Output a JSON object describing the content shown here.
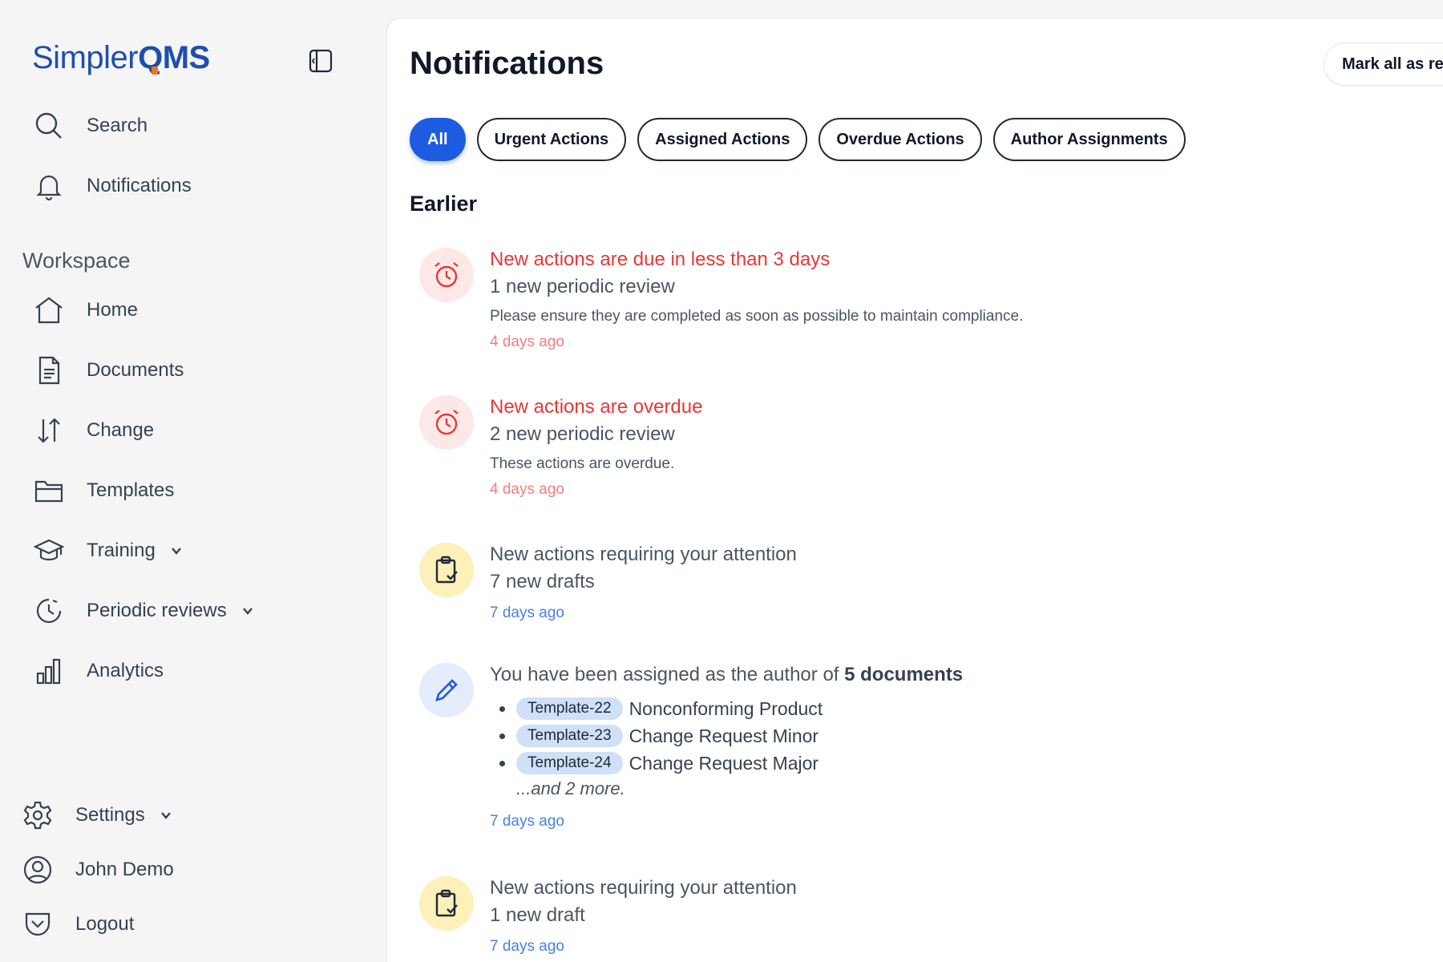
{
  "brand": {
    "name_light": "Simpler",
    "name_q": "Q",
    "name_bold": "MS"
  },
  "sidebar": {
    "top_items": [
      {
        "label": "Search",
        "icon": "search-icon"
      },
      {
        "label": "Notifications",
        "icon": "bell-icon"
      }
    ],
    "section_label": "Workspace",
    "workspace_items": [
      {
        "label": "Home",
        "icon": "home-icon"
      },
      {
        "label": "Documents",
        "icon": "document-icon"
      },
      {
        "label": "Change",
        "icon": "arrows-up-down-icon"
      },
      {
        "label": "Templates",
        "icon": "folder-icon"
      },
      {
        "label": "Training",
        "icon": "graduation-cap-icon",
        "expandable": true
      },
      {
        "label": "Periodic reviews",
        "icon": "clock-cycle-icon",
        "expandable": true
      },
      {
        "label": "Analytics",
        "icon": "bar-chart-icon"
      }
    ],
    "bottom_items": [
      {
        "label": "Settings",
        "icon": "gear-icon",
        "expandable": true
      },
      {
        "label": "John Demo",
        "icon": "user-circle-icon"
      },
      {
        "label": "Logout",
        "icon": "logout-icon"
      }
    ]
  },
  "main": {
    "title": "Notifications",
    "mark_all_label": "Mark all as re",
    "filters": [
      {
        "label": "All",
        "active": true
      },
      {
        "label": "Urgent Actions",
        "active": false
      },
      {
        "label": "Assigned Actions",
        "active": false
      },
      {
        "label": "Overdue Actions",
        "active": false
      },
      {
        "label": "Author Assignments",
        "active": false
      }
    ],
    "group_label": "Earlier",
    "notifications": [
      {
        "type": "urgent",
        "icon": "alarm-clock-icon",
        "title": "New actions are due in less than 3 days",
        "subtitle": "1 new periodic review",
        "description": "Please ensure they are completed as soon as possible to maintain compliance.",
        "time": "4 days ago"
      },
      {
        "type": "overdue",
        "icon": "alarm-clock-icon",
        "title": "New actions are overdue",
        "subtitle": "2 new periodic review",
        "description": "These actions are overdue.",
        "time": "4 days ago"
      },
      {
        "type": "attention",
        "icon": "clipboard-check-icon",
        "title": "New actions requiring your attention",
        "subtitle": "7 new drafts",
        "time": "7 days ago"
      },
      {
        "type": "author",
        "icon": "pencil-icon",
        "title_prefix": "You have been assigned as the author of ",
        "title_bold": "5 documents",
        "documents": [
          {
            "tag": "Template-22",
            "name": "Nonconforming Product"
          },
          {
            "tag": "Template-23",
            "name": "Change Request Minor"
          },
          {
            "tag": "Template-24",
            "name": "Change Request Major"
          }
        ],
        "more": "...and 2 more.",
        "time": "7 days ago"
      },
      {
        "type": "attention",
        "icon": "clipboard-check-icon",
        "title": "New actions requiring your attention",
        "subtitle": "1 new draft",
        "time": "7 days ago"
      }
    ]
  },
  "colors": {
    "accent": "#1d5be0",
    "urgent_red": "#e53935",
    "time_red": "#f47c7c",
    "time_blue": "#4a7fe3",
    "tag_bg": "#cfe0f7"
  }
}
